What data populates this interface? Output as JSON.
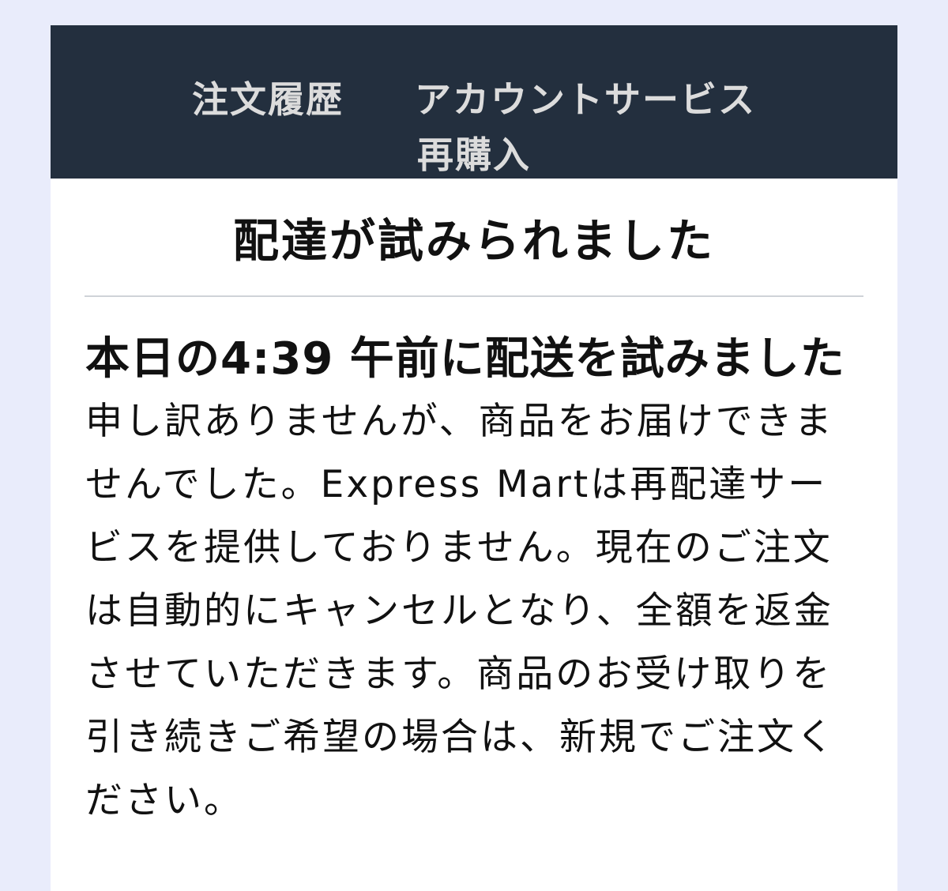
{
  "nav": {
    "order_history": "注文履歴",
    "account_service": "アカウントサービス",
    "reorder": "再購入"
  },
  "page_title": "配達が試みられました",
  "notice": {
    "headline": "本日の4:39 午前に配送を試みました",
    "body": "申し訳ありませんが、商品をお届けできませんでした。Express Martは再配達サービスを提供しておりません。現在のご注文は自動的にキャンセルとなり、全額を返金させていただきます。商品のお受け取りを引き続きご希望の場合は、新規でご注文ください。"
  },
  "colors": {
    "page_background": "#e9ecfb",
    "nav_background": "#232f3e",
    "nav_text": "#dcdcdc",
    "divider": "#cfd3d8"
  }
}
